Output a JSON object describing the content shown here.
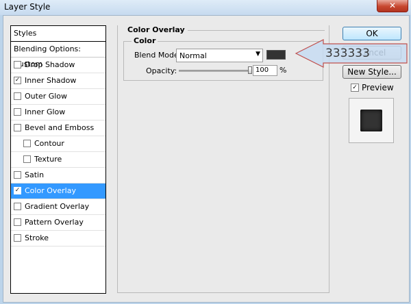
{
  "window": {
    "title": "Layer Style",
    "close_glyph": "✕"
  },
  "styles_list": {
    "header": "Styles",
    "blending_options": "Blending Options: Custom",
    "items": [
      {
        "label": "Drop Shadow",
        "checked": false,
        "sub": false,
        "selected": false
      },
      {
        "label": "Inner Shadow",
        "checked": true,
        "sub": false,
        "selected": false
      },
      {
        "label": "Outer Glow",
        "checked": false,
        "sub": false,
        "selected": false
      },
      {
        "label": "Inner Glow",
        "checked": false,
        "sub": false,
        "selected": false
      },
      {
        "label": "Bevel and Emboss",
        "checked": false,
        "sub": false,
        "selected": false
      },
      {
        "label": "Contour",
        "checked": false,
        "sub": true,
        "selected": false
      },
      {
        "label": "Texture",
        "checked": false,
        "sub": true,
        "selected": false
      },
      {
        "label": "Satin",
        "checked": false,
        "sub": false,
        "selected": false
      },
      {
        "label": "Color Overlay",
        "checked": true,
        "sub": false,
        "selected": true
      },
      {
        "label": "Gradient Overlay",
        "checked": false,
        "sub": false,
        "selected": false
      },
      {
        "label": "Pattern Overlay",
        "checked": false,
        "sub": false,
        "selected": false
      },
      {
        "label": "Stroke",
        "checked": false,
        "sub": false,
        "selected": false
      }
    ]
  },
  "color_overlay": {
    "section_title": "Color Overlay",
    "group_title": "Color",
    "blend_mode_label": "Blend Mode:",
    "blend_mode_value": "Normal",
    "swatch_color": "#333333",
    "opacity_label": "Opacity:",
    "opacity_value": "100",
    "opacity_unit": "%",
    "opacity_fraction": 1.0
  },
  "buttons": {
    "ok": "OK",
    "cancel": "Cancel",
    "new_style": "New Style...",
    "preview_label": "Preview",
    "preview_checked": true
  },
  "preview_color": "#333333",
  "callout": {
    "text": "333333"
  }
}
